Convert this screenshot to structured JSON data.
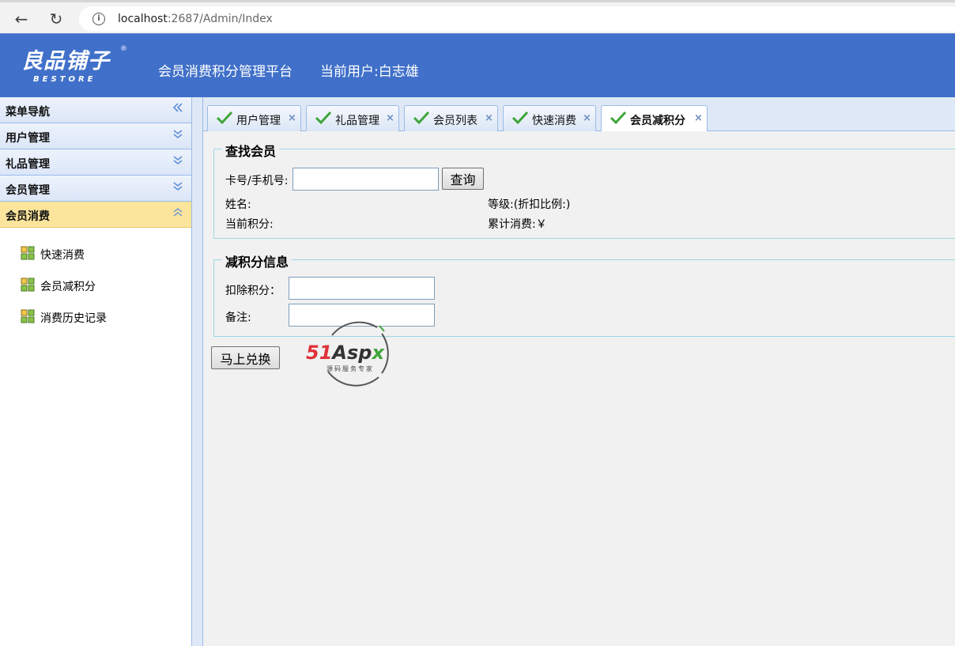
{
  "browser": {
    "url_host": "localhost",
    "url_path": ":2687/Admin/Index"
  },
  "header": {
    "logo_text": "良品铺子",
    "logo_sub": "BESTORE",
    "logo_reg": "®",
    "platform_title": "会员消费积分管理平台",
    "current_user": "当前用户:白志雄"
  },
  "sidebar": {
    "sections": [
      {
        "label": "菜单导航",
        "icon": "double-chevron-left-icon"
      },
      {
        "label": "用户管理",
        "icon": "double-chevron-down-icon"
      },
      {
        "label": "礼品管理",
        "icon": "double-chevron-down-icon"
      },
      {
        "label": "会员管理",
        "icon": "double-chevron-down-icon"
      },
      {
        "label": "会员消费",
        "icon": "double-chevron-up-icon"
      }
    ],
    "items": [
      {
        "label": "快速消费"
      },
      {
        "label": "会员减积分"
      },
      {
        "label": "消费历史记录"
      }
    ]
  },
  "tabs": [
    {
      "label": "用户管理"
    },
    {
      "label": "礼品管理"
    },
    {
      "label": "会员列表"
    },
    {
      "label": "快速消费"
    },
    {
      "label": "会员减积分",
      "active": true
    }
  ],
  "tab_close": "×",
  "search": {
    "legend": "查找会员",
    "card_label": "卡号/手机号:",
    "card_value": "",
    "query_button": "查询",
    "name_label": "姓名:",
    "level_label": "等级:(折扣比例:)",
    "points_label": "当前积分:",
    "total_label": "累计消费:￥"
  },
  "deduct": {
    "legend": "减积分信息",
    "points_label": "扣除积分：",
    "points_value": "",
    "remark_label": "备注:",
    "remark_value": "",
    "submit_button": "马上兑换"
  },
  "watermark": {
    "brand_red": "51",
    "brand_dark": "Asp",
    "brand_green": "x",
    "tagline": "源码服务专家"
  },
  "colors": {
    "header_bg": "#4070c9",
    "active_section_bg": "#fbe49b",
    "border": "#99bbe8",
    "fieldset_border": "#9ed6e6"
  }
}
